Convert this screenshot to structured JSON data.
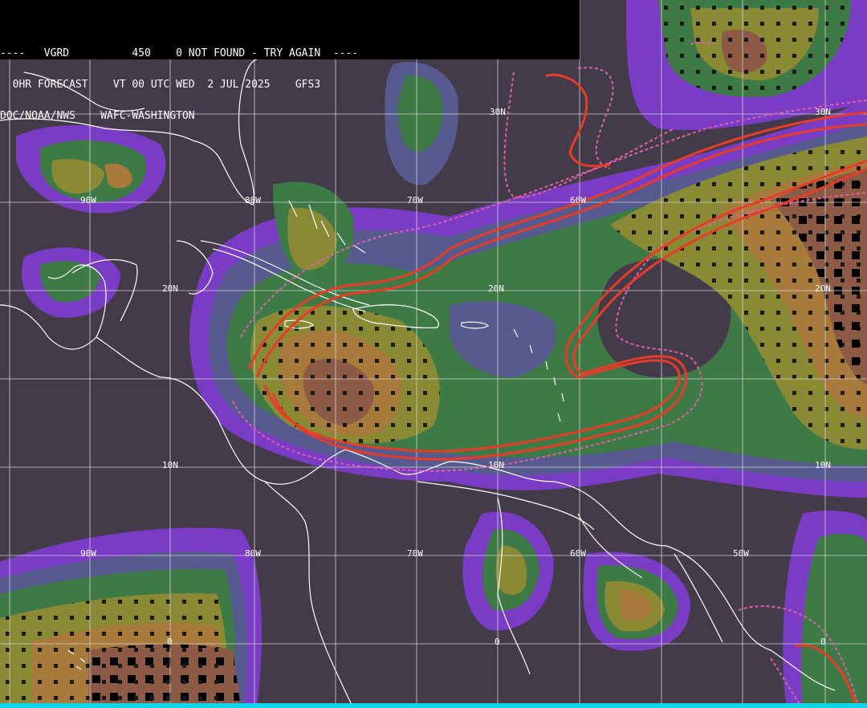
{
  "header": {
    "line1": "----   VGRD          450    0 NOT FOUND - TRY AGAIN  ----",
    "line2": "  0HR FORECAST    VT 00 UTC WED  2 JUL 2025    GFS3",
    "line3": "DOC/NOAA/NWS    WAFC-WASHINGTON"
  },
  "grid_labels": {
    "lat": [
      "30N",
      "20N",
      "10N",
      "0"
    ],
    "lon": [
      "90W",
      "80W",
      "70W",
      "60W",
      "50W"
    ]
  },
  "colors": {
    "background": "#443b4a",
    "purple": "#7a3cc4",
    "slate": "#565a8e",
    "green": "#3e7a45",
    "olive": "#8a8a35",
    "orange": "#a87a3c",
    "brown": "#8c5a45",
    "contour": "#e83c28",
    "dashed": "#e060a8",
    "coast": "#ffffff",
    "grid": "#d0d0d0",
    "footer": "#12d4e8"
  }
}
